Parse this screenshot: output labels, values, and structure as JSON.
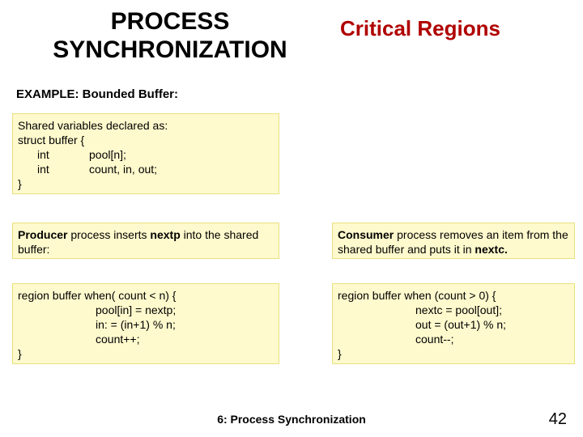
{
  "header": {
    "title_left": "PROCESS SYNCHRONIZATION",
    "title_right": "Critical Regions"
  },
  "example_label": "EXAMPLE:   Bounded Buffer:",
  "shared": {
    "line1": "Shared variables declared as:",
    "line2": "struct buffer {",
    "row1_kw": "int",
    "row1_rest": "pool[n];",
    "row2_kw": "int",
    "row2_rest": "count, in, out;",
    "close": "}"
  },
  "producer": {
    "desc_b1": "Producer",
    "desc_mid": " process inserts ",
    "desc_b2": "nextp",
    "desc_rest": " into the shared buffer:",
    "code1": "region   buffer  when( count < n) {",
    "code2": "pool[in] = nextp;",
    "code3": "in: = (in+1) % n;",
    "code4": "count++;",
    "close": "}"
  },
  "consumer": {
    "desc_b1": "Consumer",
    "desc_mid": " process removes an item from the shared buffer and puts it in   ",
    "desc_b2": "nextc.",
    "code1": "region  buffer  when (count > 0) {",
    "code2": "nextc = pool[out];",
    "code3": "out = (out+1) % n;",
    "code4": "count--;",
    "close": "}"
  },
  "footer": {
    "title": "6: Process Synchronization",
    "page": "42"
  }
}
